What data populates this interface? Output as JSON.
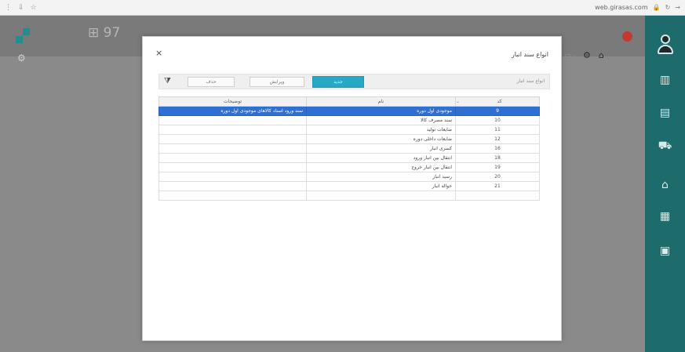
{
  "browser": {
    "url": "web.girasas.com",
    "version_text": "97"
  },
  "modal": {
    "title": "انواع سند انبار",
    "close_label": "×",
    "toolbar": {
      "caption": "انواع سند انبار",
      "new_label": "جدید",
      "edit_label": "ویرایش",
      "delete_label": "حذف"
    },
    "columns": {
      "code": "کد",
      "name": "نام",
      "description": "توضیحات"
    },
    "rows": [
      {
        "code": "9",
        "name": "موجودی اول دوره",
        "description": "سند ورود اسناد کالاهای موجودی اول دوره",
        "selected": true
      },
      {
        "code": "10",
        "name": "سند مصرف کالا",
        "description": "",
        "selected": false
      },
      {
        "code": "11",
        "name": "ضایعات تولید",
        "description": "",
        "selected": false
      },
      {
        "code": "12",
        "name": "ضایعات داخلی دوره",
        "description": "",
        "selected": false
      },
      {
        "code": "16",
        "name": "کسری انبار",
        "description": "",
        "selected": false
      },
      {
        "code": "18",
        "name": "انتقال بین انبار ورود",
        "description": "",
        "selected": false
      },
      {
        "code": "19",
        "name": "انتقال بین انبار خروج",
        "description": "",
        "selected": false
      },
      {
        "code": "20",
        "name": "رسید انبار",
        "description": "",
        "selected": false
      },
      {
        "code": "21",
        "name": "حواله انبار",
        "description": "",
        "selected": false
      },
      {
        "code": "",
        "name": "",
        "description": "",
        "selected": false
      }
    ]
  },
  "sidebar": {
    "items": [
      {
        "icon": "chart-icon"
      },
      {
        "icon": "list-icon"
      },
      {
        "icon": "cart-icon"
      },
      {
        "icon": "bank-icon"
      },
      {
        "icon": "grid-icon"
      },
      {
        "icon": "report-icon"
      }
    ]
  },
  "colors": {
    "sidebar": "#1e6b6b",
    "accent_button": "#27a9c6",
    "selected_row": "#2e6fd4",
    "notification": "#c23b2e"
  }
}
